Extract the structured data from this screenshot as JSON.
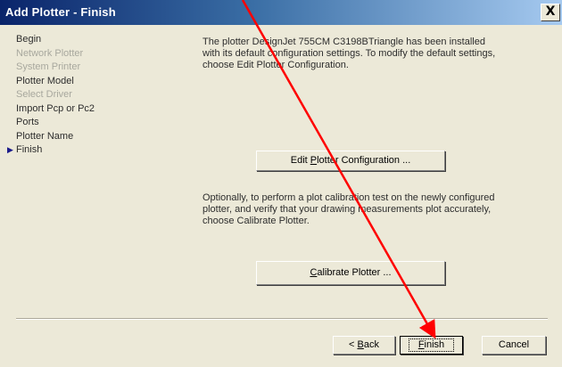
{
  "window": {
    "title": "Add Plotter - Finish",
    "close_label": "X"
  },
  "steps": [
    {
      "label": "Begin",
      "state": "enabled"
    },
    {
      "label": "Network Plotter",
      "state": "disabled"
    },
    {
      "label": "System Printer",
      "state": "disabled"
    },
    {
      "label": "Plotter Model",
      "state": "enabled"
    },
    {
      "label": "Select Driver",
      "state": "disabled"
    },
    {
      "label": "Import Pcp or Pc2",
      "state": "enabled"
    },
    {
      "label": "Ports",
      "state": "enabled"
    },
    {
      "label": "Plotter Name",
      "state": "enabled"
    },
    {
      "label": "Finish",
      "state": "current"
    }
  ],
  "content": {
    "description_1": "The plotter DesignJet 755CM C3198BTriangle has been installed with its default configuration settings.  To modify the default settings, choose Edit Plotter Configuration.",
    "edit_button": {
      "before": "Edit ",
      "mnemonic": "P",
      "after": "lotter Configuration ..."
    },
    "description_2": "Optionally, to perform a plot calibration test on the newly configured plotter, and verify that your drawing measurements plot accurately, choose Calibrate Plotter.",
    "calibrate_button": {
      "before": "",
      "mnemonic": "C",
      "after": "alibrate Plotter ..."
    }
  },
  "footer": {
    "back_button": {
      "before": "< ",
      "mnemonic": "B",
      "after": "ack"
    },
    "finish_button": {
      "before": "",
      "mnemonic": "F",
      "after": "inish"
    },
    "cancel_button": {
      "label": "Cancel"
    }
  },
  "annotation": {
    "arrow_color": "#ff0000",
    "icon": "red-arrow"
  },
  "colors": {
    "title_start": "#0a246a",
    "title_end": "#a6caf0",
    "dialog_bg": "#ece9d8",
    "disabled_text": "#a8a89e"
  }
}
